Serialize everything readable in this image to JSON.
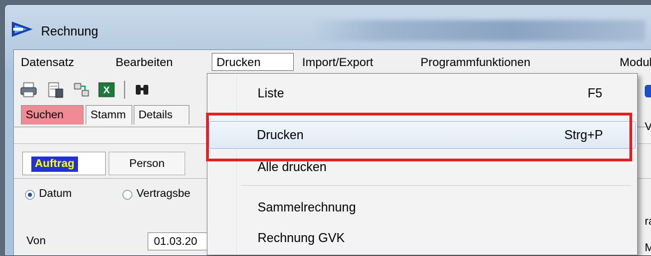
{
  "window": {
    "title": "Rechnung"
  },
  "menubar": {
    "items": [
      "Datensatz",
      "Bearbeiten",
      "Drucken",
      "Import/Export",
      "Programmfunktionen",
      "Modul"
    ]
  },
  "tabs": {
    "suchen": "Suchen",
    "stamm": "Stamm",
    "details": "Details"
  },
  "subtabs": {
    "auftrag": "Auftrag",
    "person": "Person"
  },
  "filters": {
    "datum": "Datum",
    "vertragsbe": "Vertragsbe"
  },
  "von": {
    "label": "Von",
    "value": "01.03.20"
  },
  "dropdown": {
    "items": [
      {
        "label": "Liste",
        "shortcut": "F5"
      },
      {
        "label": "Drucken",
        "shortcut": "Strg+P"
      },
      {
        "label": "Alle drucken",
        "shortcut": ""
      },
      {
        "label": "Sammelrechnung",
        "shortcut": ""
      },
      {
        "label": "Rechnung GVK",
        "shortcut": ""
      }
    ]
  },
  "right_edge": {
    "t1": "Vo",
    "t2": "ra",
    "t3": "M"
  },
  "colors": {
    "highlight": "#e32226",
    "suchen_tab": "#f28a96",
    "auftrag_bg": "#2232d8",
    "auftrag_fg": "#ffff00"
  }
}
